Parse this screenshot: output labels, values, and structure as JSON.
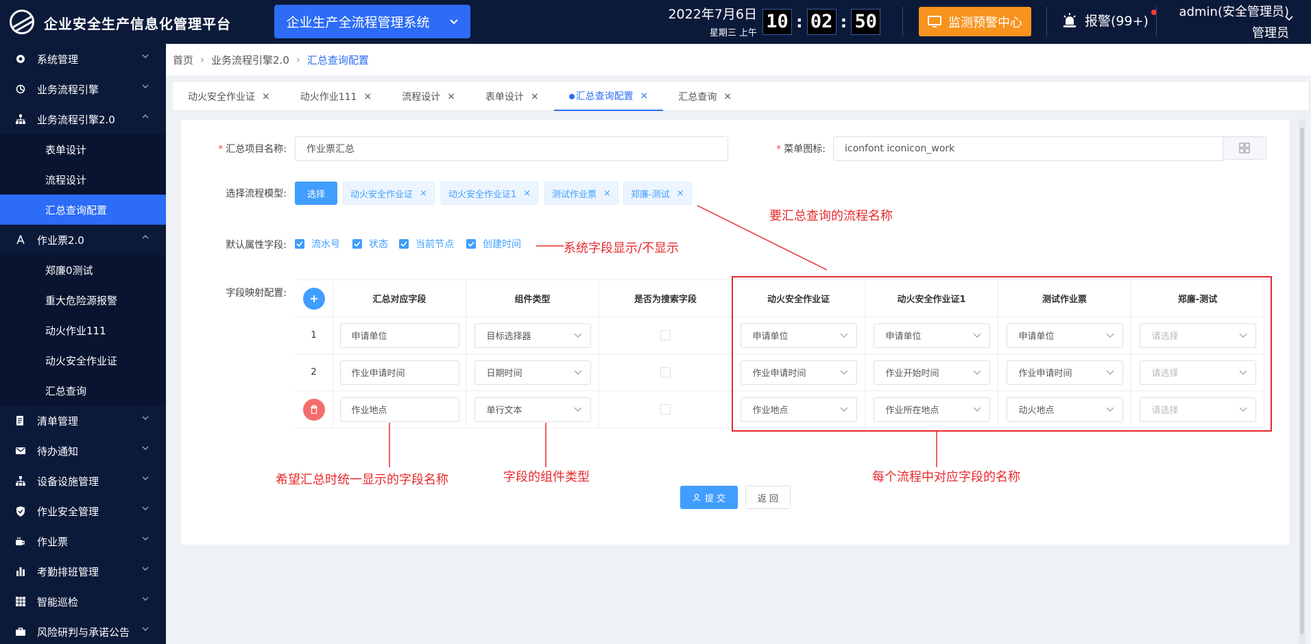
{
  "header": {
    "app_title": "企业安全生产信息化管理平台",
    "system_select": "企业生产全流程管理系统",
    "date": "2022年7月6日",
    "weekday": "星期三  上午",
    "clock": {
      "hh": "10",
      "mm": "02",
      "ss": "50"
    },
    "monitor_center": "监测预警中心",
    "alarm": "报警(99+)",
    "user_name": "admin(安全管理员)",
    "user_role": "管理员"
  },
  "sidebar": {
    "items": [
      {
        "label": "系统管理",
        "icon": "gear-icon"
      },
      {
        "label": "业务流程引擎",
        "icon": "flow-icon"
      },
      {
        "label": "业务流程引擎2.0",
        "icon": "org-icon"
      },
      {
        "label": "作业票2.0",
        "icon": "compass-icon"
      },
      {
        "label": "清单管理",
        "icon": "list-icon"
      },
      {
        "label": "待办通知",
        "icon": "mail-icon"
      },
      {
        "label": "设备设施管理",
        "icon": "org-icon"
      },
      {
        "label": "作业安全管理",
        "icon": "shield-icon"
      },
      {
        "label": "作业票",
        "icon": "ticket-icon"
      },
      {
        "label": "考勤排班管理",
        "icon": "bar-chart-icon"
      },
      {
        "label": "智能巡检",
        "icon": "grid-icon"
      },
      {
        "label": "风险研判与承诺公告",
        "icon": "briefcase-icon"
      }
    ],
    "sub_bpm": [
      "表单设计",
      "流程设计",
      "汇总查询配置"
    ],
    "sub_ticket": [
      "郑廉0测试",
      "重大危险源报警",
      "动火作业111",
      "动火安全作业证",
      "汇总查询"
    ]
  },
  "breadcrumb": [
    "首页",
    "业务流程引擎2.0",
    "汇总查询配置"
  ],
  "tabs": [
    "动火安全作业证",
    "动火作业111",
    "流程设计",
    "表单设计",
    "汇总查询配置",
    "汇总查询"
  ],
  "form": {
    "name_label": "汇总项目名称:",
    "name_value": "作业票汇总",
    "icon_label": "菜单图标:",
    "icon_value": "iconfont iconicon_work",
    "model_label": "选择流程模型:",
    "select_btn": "选择",
    "model_tags": [
      "动火安全作业证",
      "动火安全作业证1",
      "测试作业票",
      "郑廉-测试"
    ],
    "default_label": "默认属性字段:",
    "default_fields": [
      "流水号",
      "状态",
      "当前节点",
      "创建时间"
    ],
    "mapping_label": "字段映射配置:"
  },
  "table": {
    "headers": [
      "汇总对应字段",
      "组件类型",
      "是否为搜索字段",
      "动火安全作业证",
      "动火安全作业证1",
      "测试作业票",
      "郑廉-测试"
    ],
    "rows": [
      {
        "index": "1",
        "field": "申请单位",
        "type": "目标选择器",
        "maps": [
          "申请单位",
          "申请单位",
          "申请单位",
          "请选择"
        ]
      },
      {
        "index": "2",
        "field": "作业申请时间",
        "type": "日期时间",
        "maps": [
          "作业申请时间",
          "作业开始时间",
          "作业申请时间",
          "请选择"
        ]
      },
      {
        "index": "",
        "field": "作业地点",
        "type": "单行文本",
        "maps": [
          "作业地点",
          "作业所在地点",
          "动火地点",
          "请选择"
        ]
      }
    ]
  },
  "actions": {
    "submit": "提 交",
    "back": "返 回"
  },
  "annotations": {
    "process_names": "要汇总查询的流程名称",
    "system_fields": "系统字段显示/不显示",
    "unified_name": "希望汇总时统一显示的字段名称",
    "component_type": "字段的组件类型",
    "per_process": "每个流程中对应字段的名称"
  },
  "colors": {
    "header_bg": "#0c1a3a",
    "accent": "#2c6cf6",
    "warning": "#f7931e",
    "annotation": "#e8292d",
    "primary_btn": "#409eff"
  }
}
